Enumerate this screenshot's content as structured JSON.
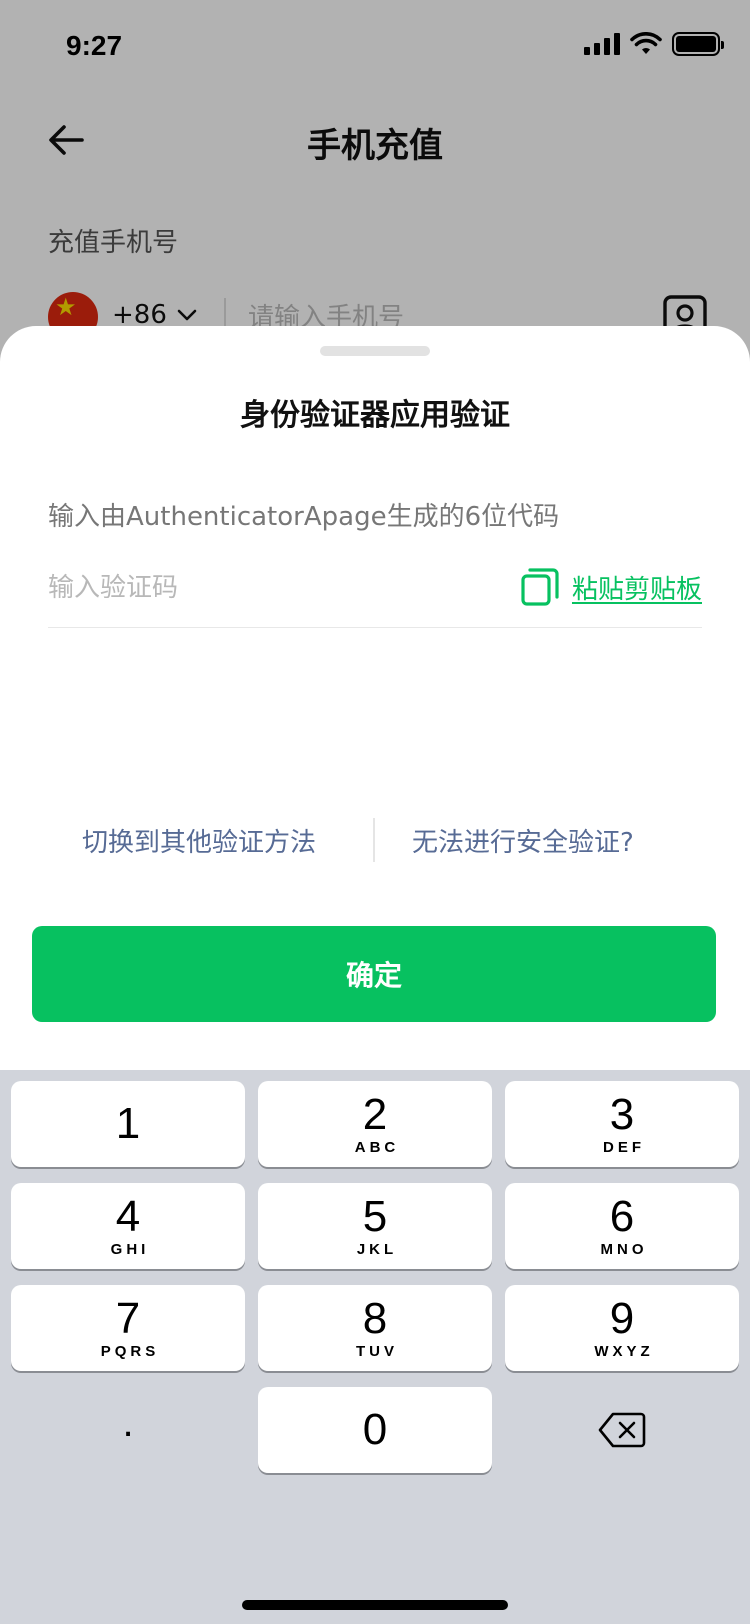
{
  "status_bar": {
    "time": "9:27"
  },
  "background_page": {
    "title": "手机充值",
    "section_label": "充值手机号",
    "country_code": "+86",
    "phone_placeholder": "请输入手机号"
  },
  "sheet": {
    "title": "身份验证器应用验证",
    "description": "输入由AuthenticatorApage生成的6位代码",
    "code_placeholder": "输入验证码",
    "paste_label": "粘贴剪贴板",
    "switch_method_label": "切换到其他验证方法",
    "cannot_verify_label": "无法进行安全验证?",
    "confirm_label": "确定"
  },
  "keypad": {
    "keys": [
      {
        "digit": "1",
        "letters": ""
      },
      {
        "digit": "2",
        "letters": "ABC"
      },
      {
        "digit": "3",
        "letters": "DEF"
      },
      {
        "digit": "4",
        "letters": "GHI"
      },
      {
        "digit": "5",
        "letters": "JKL"
      },
      {
        "digit": "6",
        "letters": "MNO"
      },
      {
        "digit": "7",
        "letters": "PQRS"
      },
      {
        "digit": "8",
        "letters": "TUV"
      },
      {
        "digit": "9",
        "letters": "WXYZ"
      }
    ],
    "dot_label": ".",
    "zero_digit": "0"
  },
  "icons": {
    "back": "arrow-left-icon",
    "flag": "china-flag-icon",
    "chevron": "chevron-down-icon",
    "contacts": "contacts-icon",
    "paste": "copy-icon",
    "delete": "backspace-icon"
  },
  "colors": {
    "accent_green": "#07c160",
    "link_blue": "#576b95",
    "keypad_bg": "#d1d4db"
  }
}
